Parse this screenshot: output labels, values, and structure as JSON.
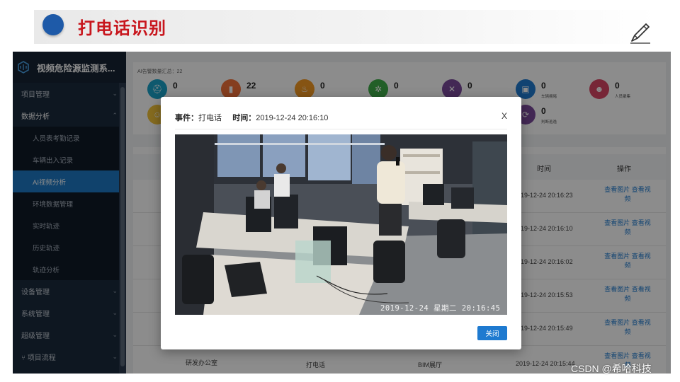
{
  "slide": {
    "title": "打电话识别",
    "watermark": "CSDN @希哈科技"
  },
  "app": {
    "title": "视频危险源监测系...",
    "sidebar": {
      "items": [
        {
          "label": "项目管理",
          "chevron": "chevron-down"
        },
        {
          "label": "数据分析",
          "chevron": "chevron-up"
        }
      ],
      "submenu": [
        {
          "label": "人员表考勤记录"
        },
        {
          "label": "车辆出入记录"
        },
        {
          "label": "AI视频分析",
          "active": true
        },
        {
          "label": "环境数据管理"
        },
        {
          "label": "实时轨迹"
        },
        {
          "label": "历史轨迹"
        },
        {
          "label": "轨迹分析"
        }
      ],
      "bottom_items": [
        {
          "label": "设备管理"
        },
        {
          "label": "系统管理"
        },
        {
          "label": "超级管理"
        },
        {
          "label": "项目流程"
        }
      ]
    },
    "stats": {
      "caption": "AI告警数量汇总：22",
      "items": [
        {
          "value": "0",
          "color": "#1aa3c8",
          "icon": "helmet-icon"
        },
        {
          "value": "22",
          "color": "#f2713a",
          "icon": "phone-icon"
        },
        {
          "value": "0",
          "color": "#f59a23",
          "icon": "fire-icon"
        },
        {
          "value": "0",
          "color": "#3fae49",
          "icon": "smoke-icon"
        },
        {
          "value": "0",
          "color": "#7a4a9c",
          "icon": "ban-icon"
        },
        {
          "value": "0",
          "label": "车辆拥堵",
          "color": "#1f7bd0",
          "icon": "car-icon"
        },
        {
          "value": "0",
          "label": "人员聚集",
          "color": "#d94564",
          "icon": "crowd-icon"
        },
        {
          "value": "0",
          "label": "判断逃逸",
          "color": "#7a4a9c",
          "icon": "run-icon"
        },
        {
          "value": "",
          "color": "#f2c33a",
          "icon": "user-icon"
        }
      ]
    },
    "table": {
      "headers": {
        "time": "时间",
        "action": "操作"
      },
      "rows": [
        {
          "time": "2019-12-24 20:16:23"
        },
        {
          "time": "2019-12-24 20:16:10"
        },
        {
          "time": "2019-12-24 20:16:02"
        },
        {
          "time": "2019-12-24 20:15:53"
        },
        {
          "time": "2019-12-24 20:15:49"
        },
        {
          "location": "研发办公室",
          "event": "打电话",
          "camera": "BIM展厅",
          "time": "2019-12-24 20:15:44"
        }
      ],
      "op_view_image": "查看图片",
      "op_view_video": "查看视频"
    }
  },
  "modal": {
    "event_label": "事件：",
    "event_value": "打电话",
    "time_label": "时间：",
    "time_value": "2019-12-24 20:16:10",
    "close_x": "X",
    "video_timestamp": "2019-12-24 星期二 20:16:45",
    "close_button": "关闭"
  }
}
